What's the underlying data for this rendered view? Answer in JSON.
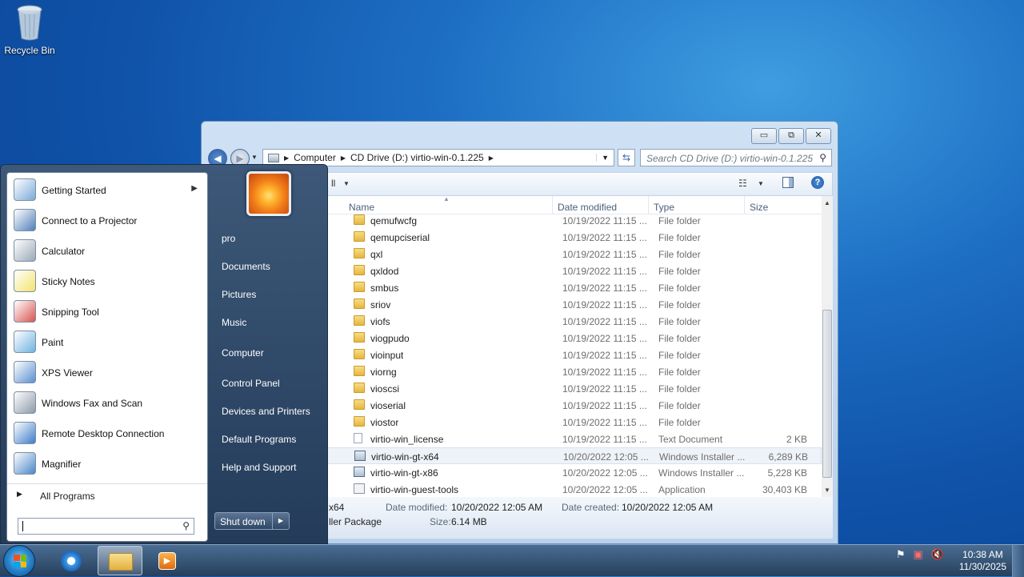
{
  "desktop": {
    "recycle_bin_label": "Recycle Bin"
  },
  "explorer": {
    "window_buttons": {
      "minimize": "▭",
      "maximize": "⧉",
      "close": "✕"
    },
    "breadcrumb": [
      "Computer",
      "CD Drive (D:) virtio-win-0.1.225"
    ],
    "search_placeholder": "Search CD Drive (D:) virtio-win-0.1.225",
    "columns": {
      "name": "Name",
      "date": "Date modified",
      "type": "Type",
      "size": "Size"
    },
    "files": [
      {
        "name": "qemufwcfg",
        "date": "10/19/2022 11:15 ...",
        "type": "File folder",
        "size": "",
        "icon": "folder-icon"
      },
      {
        "name": "qemupciserial",
        "date": "10/19/2022 11:15 ...",
        "type": "File folder",
        "size": "",
        "icon": "folder-icon"
      },
      {
        "name": "qxl",
        "date": "10/19/2022 11:15 ...",
        "type": "File folder",
        "size": "",
        "icon": "folder-icon"
      },
      {
        "name": "qxldod",
        "date": "10/19/2022 11:15 ...",
        "type": "File folder",
        "size": "",
        "icon": "folder-icon"
      },
      {
        "name": "smbus",
        "date": "10/19/2022 11:15 ...",
        "type": "File folder",
        "size": "",
        "icon": "folder-icon"
      },
      {
        "name": "sriov",
        "date": "10/19/2022 11:15 ...",
        "type": "File folder",
        "size": "",
        "icon": "folder-icon"
      },
      {
        "name": "viofs",
        "date": "10/19/2022 11:15 ...",
        "type": "File folder",
        "size": "",
        "icon": "folder-icon"
      },
      {
        "name": "viogpudo",
        "date": "10/19/2022 11:15 ...",
        "type": "File folder",
        "size": "",
        "icon": "folder-icon"
      },
      {
        "name": "vioinput",
        "date": "10/19/2022 11:15 ...",
        "type": "File folder",
        "size": "",
        "icon": "folder-icon"
      },
      {
        "name": "viorng",
        "date": "10/19/2022 11:15 ...",
        "type": "File folder",
        "size": "",
        "icon": "folder-icon"
      },
      {
        "name": "vioscsi",
        "date": "10/19/2022 11:15 ...",
        "type": "File folder",
        "size": "",
        "icon": "folder-icon"
      },
      {
        "name": "vioserial",
        "date": "10/19/2022 11:15 ...",
        "type": "File folder",
        "size": "",
        "icon": "folder-icon"
      },
      {
        "name": "viostor",
        "date": "10/19/2022 11:15 ...",
        "type": "File folder",
        "size": "",
        "icon": "folder-icon"
      },
      {
        "name": "virtio-win_license",
        "date": "10/19/2022 11:15 ...",
        "type": "Text Document",
        "size": "2 KB",
        "icon": "text-document-icon"
      },
      {
        "name": "virtio-win-gt-x64",
        "date": "10/20/2022 12:05 ...",
        "type": "Windows Installer ...",
        "size": "6,289 KB",
        "icon": "installer-icon",
        "selected": true
      },
      {
        "name": "virtio-win-gt-x86",
        "date": "10/20/2022 12:05 ...",
        "type": "Windows Installer ...",
        "size": "5,228 KB",
        "icon": "installer-icon"
      },
      {
        "name": "virtio-win-guest-tools",
        "date": "10/20/2022 12:05 ...",
        "type": "Application",
        "size": "30,403 KB",
        "icon": "application-icon"
      }
    ],
    "details": {
      "name_fragment": "x64",
      "type_fragment": "ller Package",
      "date_modified_label": "Date modified:",
      "date_modified_value": "10/20/2022 12:05 AM",
      "date_created_label": "Date created:",
      "date_created_value": "10/20/2022 12:05 AM",
      "size_label": "Size:",
      "size_value": "6.14 MB"
    }
  },
  "start_menu": {
    "programs": [
      {
        "label": "Getting Started",
        "icon": "getting-started-icon",
        "submenu": true
      },
      {
        "label": "Connect to a Projector",
        "icon": "projector-icon"
      },
      {
        "label": "Calculator",
        "icon": "calculator-icon"
      },
      {
        "label": "Sticky Notes",
        "icon": "sticky-notes-icon"
      },
      {
        "label": "Snipping Tool",
        "icon": "snipping-tool-icon"
      },
      {
        "label": "Paint",
        "icon": "paint-icon"
      },
      {
        "label": "XPS Viewer",
        "icon": "xps-viewer-icon"
      },
      {
        "label": "Windows Fax and Scan",
        "icon": "fax-scan-icon"
      },
      {
        "label": "Remote Desktop Connection",
        "icon": "remote-desktop-icon"
      },
      {
        "label": "Magnifier",
        "icon": "magnifier-icon"
      }
    ],
    "all_programs": "All Programs",
    "search_value": "",
    "right_items": [
      "pro",
      "Documents",
      "Pictures",
      "Music",
      "Computer",
      "Control Panel",
      "Devices and Printers",
      "Default Programs",
      "Help and Support"
    ],
    "shutdown": "Shut down"
  },
  "taskbar": {
    "clock_time": "10:38 AM",
    "clock_date": "11/30/2025"
  }
}
